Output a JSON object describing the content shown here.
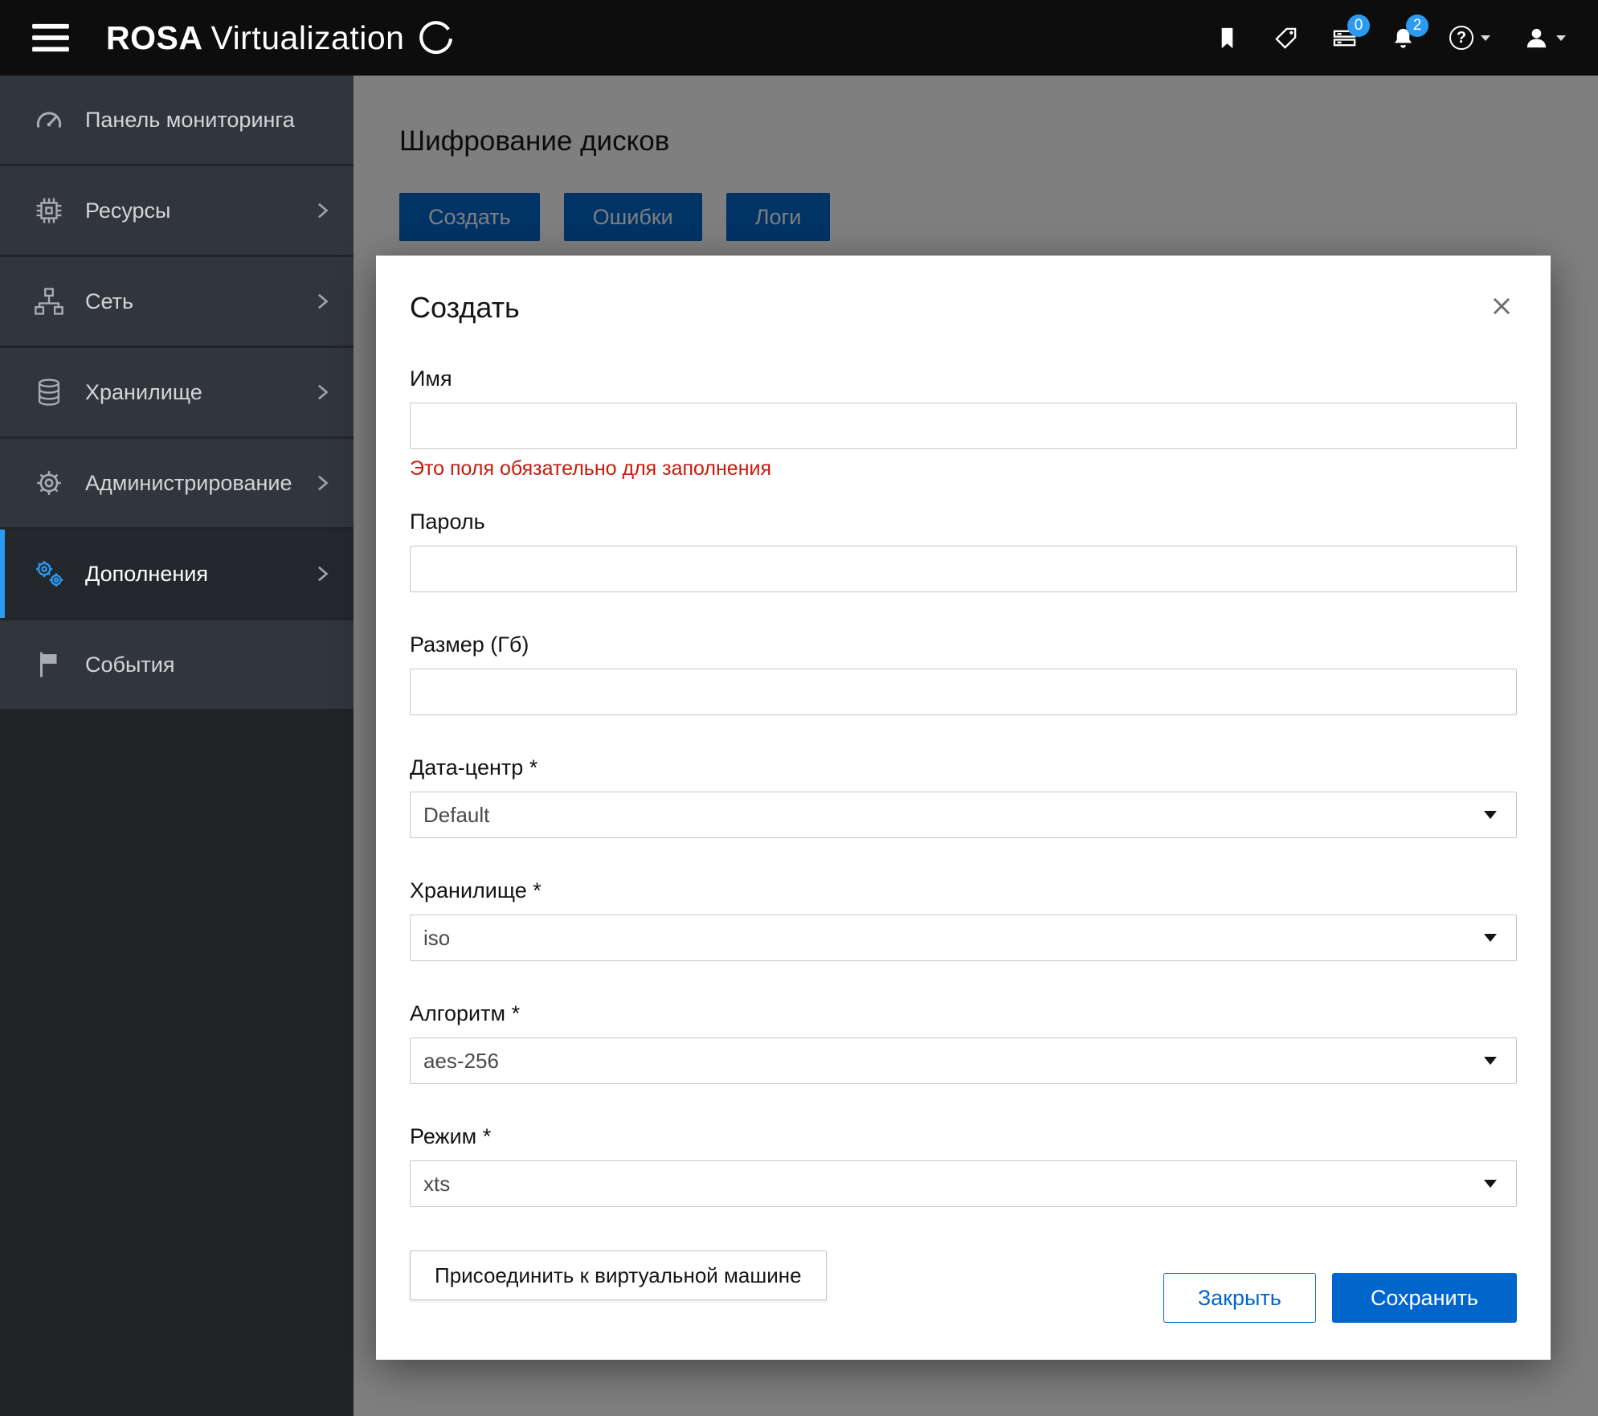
{
  "colors": {
    "accent_blue": "#0066cc",
    "badge_blue": "#2b9af3",
    "error_red": "#c9190b",
    "header_bg": "#0d0d0d",
    "sidebar_item_bg": "#31363b"
  },
  "header": {
    "brand_bold": "ROSA",
    "brand_rest": "Virtualization",
    "tasks_badge": "0",
    "notifications_badge": "2",
    "help_glyph": "?"
  },
  "sidebar": {
    "items": [
      {
        "label": "Панель мониторинга"
      },
      {
        "label": "Ресурсы"
      },
      {
        "label": "Сеть"
      },
      {
        "label": "Хранилище"
      },
      {
        "label": "Администрирование"
      },
      {
        "label": "Дополнения"
      },
      {
        "label": "События"
      }
    ]
  },
  "main": {
    "page_title": "Шифрование дисков",
    "buttons": [
      "Создать",
      "Ошибки",
      "Логи"
    ]
  },
  "modal": {
    "title": "Создать",
    "fields": [
      {
        "label": "Имя",
        "type": "text",
        "value": "",
        "error": "Это поля обязательно для заполнения"
      },
      {
        "label": "Пароль",
        "type": "text",
        "value": ""
      },
      {
        "label": "Размер (Гб)",
        "type": "text",
        "value": ""
      },
      {
        "label": "Дата-центр *",
        "type": "select",
        "value": "Default"
      },
      {
        "label": "Хранилище *",
        "type": "select",
        "value": "iso"
      },
      {
        "label": "Алгоритм *",
        "type": "select",
        "value": "aes-256"
      },
      {
        "label": "Режим *",
        "type": "select",
        "value": "xts"
      }
    ],
    "attach_button": "Присоединить к виртуальной машине",
    "footer": {
      "close": "Закрыть",
      "save": "Сохранить"
    }
  }
}
